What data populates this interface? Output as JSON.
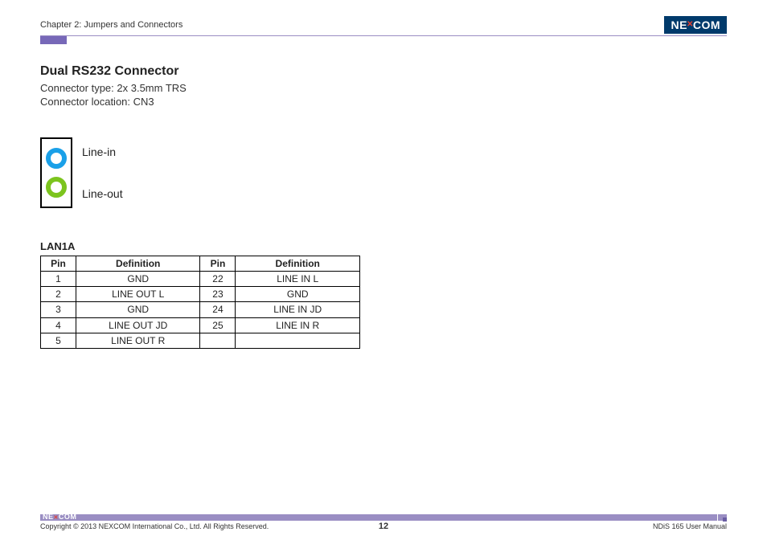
{
  "header": {
    "chapter": "Chapter 2: Jumpers and Connectors",
    "brand_pre": "NE",
    "brand_x": "✕",
    "brand_post": "COM"
  },
  "section": {
    "title": "Dual RS232 Connector",
    "meta1": "Connector type: 2x 3.5mm TRS",
    "meta2": "Connector location: CN3"
  },
  "figure": {
    "label_in": "Line-in",
    "label_out": "Line-out"
  },
  "table": {
    "title": "LAN1A",
    "head_pin": "Pin",
    "head_def": "Definition",
    "rows": [
      {
        "p1": "1",
        "d1": "GND",
        "p2": "22",
        "d2": "LINE IN L"
      },
      {
        "p1": "2",
        "d1": "LINE OUT L",
        "p2": "23",
        "d2": "GND"
      },
      {
        "p1": "3",
        "d1": "GND",
        "p2": "24",
        "d2": "LINE IN JD"
      },
      {
        "p1": "4",
        "d1": "LINE OUT JD",
        "p2": "25",
        "d2": "LINE IN R"
      },
      {
        "p1": "5",
        "d1": "LINE OUT R",
        "p2": "",
        "d2": ""
      }
    ]
  },
  "footer": {
    "copyright": "Copyright © 2013 NEXCOM International Co., Ltd. All Rights Reserved.",
    "page": "12",
    "manual": "NDiS 165 User Manual"
  }
}
